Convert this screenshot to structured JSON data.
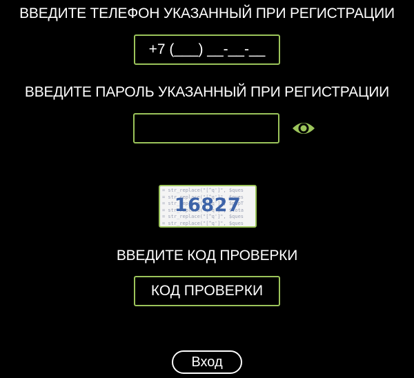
{
  "phone_section": {
    "label": "ВВЕДИТЕ ТЕЛЕФОН УКАЗАННЫЙ ПРИ РЕГИСТРАЦИИ",
    "placeholder": "+7 (___) __-__-__"
  },
  "password_section": {
    "label": "ВВЕДИТЕ ПАРОЛЬ УКАЗАННЫЙ ПРИ РЕГИСТРАЦИИ",
    "value": "",
    "toggle_icon": "eye-icon"
  },
  "captcha": {
    "code": "16827",
    "background_lines": [
      "= str_replace(\"[^q']\", $ques",
      "= str_replace(\"[^q']\", $ques",
      "= str_replace(\"[^q']\", $phpT",
      "= str_replace(\"[^q']\", $tota",
      "= str_replace(\"[^q']\", $ques",
      "= str_replace(\"[^q']\", $ques"
    ]
  },
  "code_section": {
    "label": "ВВЕДИТЕ КОД ПРОВЕРКИ",
    "placeholder": "КОД ПРОВЕРКИ"
  },
  "login_button": {
    "label": "Вход"
  },
  "colors": {
    "background": "#000000",
    "accent": "#9cc55b",
    "text": "#ffffff",
    "captcha_digits": "#3d63a8"
  }
}
